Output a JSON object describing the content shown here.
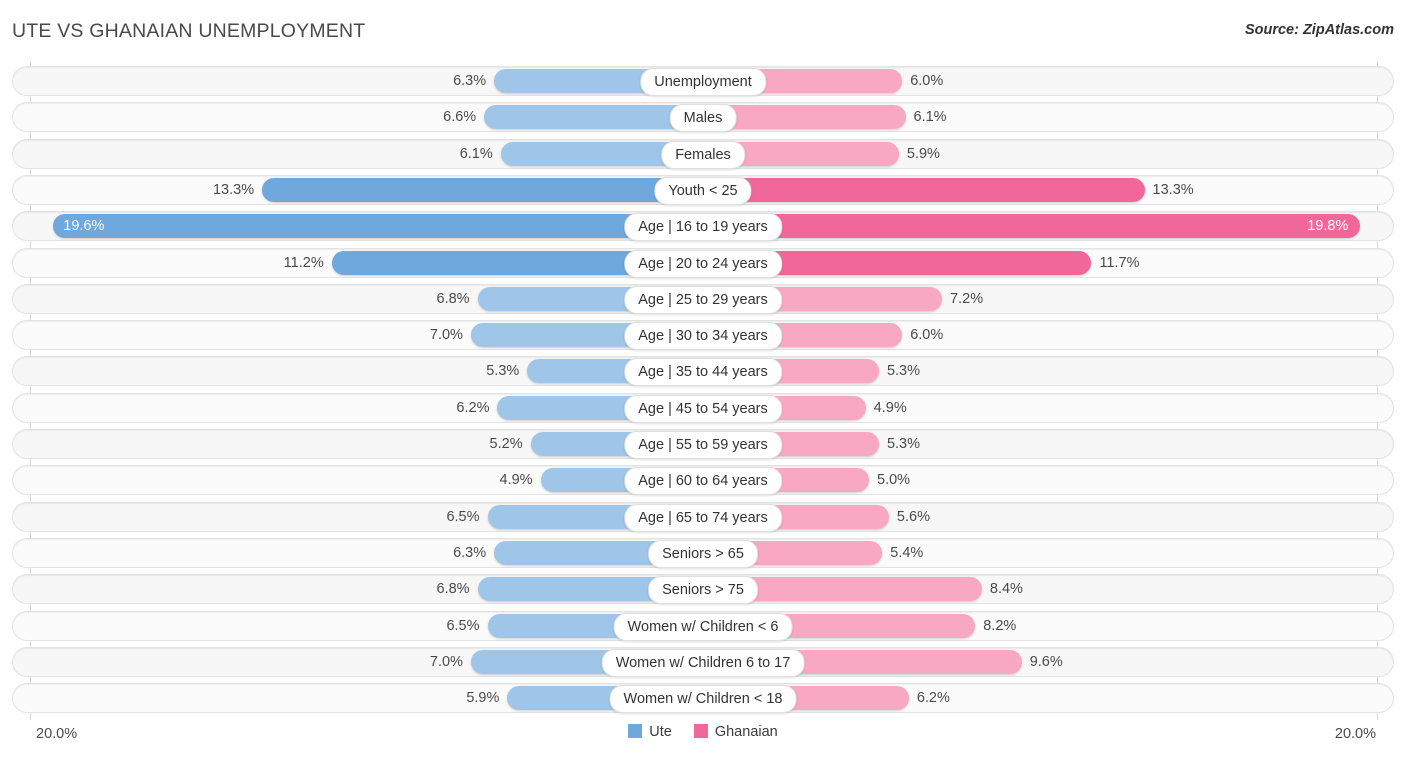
{
  "header": {
    "title": "UTE VS GHANAIAN UNEMPLOYMENT",
    "source": "Source: ZipAtlas.com"
  },
  "axis": {
    "left_tick": "20.0%",
    "right_tick": "20.0%",
    "max": 20.0
  },
  "legend": [
    {
      "label": "Ute",
      "color": "#6fa8dc"
    },
    {
      "label": "Ghanaian",
      "color": "#f2679a"
    }
  ],
  "colors": {
    "ute_light": "#9fc5e8",
    "ute_dark": "#6fa8dc",
    "ghanaian_light": "#f9a8c4",
    "ghanaian_dark": "#f2679a"
  },
  "chart_data": {
    "type": "bar",
    "title": "UTE VS GHANAIAN UNEMPLOYMENT",
    "subtitle": "Source: ZipAtlas.com",
    "orientation": "horizontal-diverging",
    "xlabel": "",
    "ylabel": "",
    "xlim": [
      20.0,
      20.0
    ],
    "grid": false,
    "legend_position": "bottom-center",
    "categories": [
      "Unemployment",
      "Males",
      "Females",
      "Youth < 25",
      "Age | 16 to 19 years",
      "Age | 20 to 24 years",
      "Age | 25 to 29 years",
      "Age | 30 to 34 years",
      "Age | 35 to 44 years",
      "Age | 45 to 54 years",
      "Age | 55 to 59 years",
      "Age | 60 to 64 years",
      "Age | 65 to 74 years",
      "Seniors > 65",
      "Seniors > 75",
      "Women w/ Children < 6",
      "Women w/ Children 6 to 17",
      "Women w/ Children < 18"
    ],
    "series": [
      {
        "name": "Ute",
        "side": "left",
        "values": [
          6.3,
          6.6,
          6.1,
          13.3,
          19.6,
          11.2,
          6.8,
          7.0,
          5.3,
          6.2,
          5.2,
          4.9,
          6.5,
          6.3,
          6.8,
          6.5,
          7.0,
          5.9
        ],
        "labels": [
          "6.3%",
          "6.6%",
          "6.1%",
          "13.3%",
          "19.6%",
          "11.2%",
          "6.8%",
          "7.0%",
          "5.3%",
          "6.2%",
          "5.2%",
          "4.9%",
          "6.5%",
          "6.3%",
          "6.8%",
          "6.5%",
          "7.0%",
          "5.9%"
        ]
      },
      {
        "name": "Ghanaian",
        "side": "right",
        "values": [
          6.0,
          6.1,
          5.9,
          13.3,
          19.8,
          11.7,
          7.2,
          6.0,
          5.3,
          4.9,
          5.3,
          5.0,
          5.6,
          5.4,
          8.4,
          8.2,
          9.6,
          6.2
        ],
        "labels": [
          "6.0%",
          "6.1%",
          "5.9%",
          "13.3%",
          "19.8%",
          "11.7%",
          "7.2%",
          "6.0%",
          "5.3%",
          "4.9%",
          "5.3%",
          "5.0%",
          "5.6%",
          "5.4%",
          "8.4%",
          "8.2%",
          "9.6%",
          "6.2%"
        ]
      }
    ]
  },
  "rows": [
    {
      "category": "Unemployment",
      "left_label": "6.3%",
      "right_label": "6.0%",
      "left_value": 6.3,
      "right_value": 6.0,
      "highlight": false
    },
    {
      "category": "Males",
      "left_label": "6.6%",
      "right_label": "6.1%",
      "left_value": 6.6,
      "right_value": 6.1,
      "highlight": false
    },
    {
      "category": "Females",
      "left_label": "6.1%",
      "right_label": "5.9%",
      "left_value": 6.1,
      "right_value": 5.9,
      "highlight": false
    },
    {
      "category": "Youth < 25",
      "left_label": "13.3%",
      "right_label": "13.3%",
      "left_value": 13.3,
      "right_value": 13.3,
      "highlight": true
    },
    {
      "category": "Age | 16 to 19 years",
      "left_label": "19.6%",
      "right_label": "19.8%",
      "left_value": 19.6,
      "right_value": 19.8,
      "highlight": true
    },
    {
      "category": "Age | 20 to 24 years",
      "left_label": "11.2%",
      "right_label": "11.7%",
      "left_value": 11.2,
      "right_value": 11.7,
      "highlight": true
    },
    {
      "category": "Age | 25 to 29 years",
      "left_label": "6.8%",
      "right_label": "7.2%",
      "left_value": 6.8,
      "right_value": 7.2,
      "highlight": false
    },
    {
      "category": "Age | 30 to 34 years",
      "left_label": "7.0%",
      "right_label": "6.0%",
      "left_value": 7.0,
      "right_value": 6.0,
      "highlight": false
    },
    {
      "category": "Age | 35 to 44 years",
      "left_label": "5.3%",
      "right_label": "5.3%",
      "left_value": 5.3,
      "right_value": 5.3,
      "highlight": false
    },
    {
      "category": "Age | 45 to 54 years",
      "left_label": "6.2%",
      "right_label": "4.9%",
      "left_value": 6.2,
      "right_value": 4.9,
      "highlight": false
    },
    {
      "category": "Age | 55 to 59 years",
      "left_label": "5.2%",
      "right_label": "5.3%",
      "left_value": 5.2,
      "right_value": 5.3,
      "highlight": false
    },
    {
      "category": "Age | 60 to 64 years",
      "left_label": "4.9%",
      "right_label": "5.0%",
      "left_value": 4.9,
      "right_value": 5.0,
      "highlight": false
    },
    {
      "category": "Age | 65 to 74 years",
      "left_label": "6.5%",
      "right_label": "5.6%",
      "left_value": 6.5,
      "right_value": 5.6,
      "highlight": false
    },
    {
      "category": "Seniors > 65",
      "left_label": "6.3%",
      "right_label": "5.4%",
      "left_value": 6.3,
      "right_value": 5.4,
      "highlight": false
    },
    {
      "category": "Seniors > 75",
      "left_label": "6.8%",
      "right_label": "8.4%",
      "left_value": 6.8,
      "right_value": 8.4,
      "highlight": false
    },
    {
      "category": "Women w/ Children < 6",
      "left_label": "6.5%",
      "right_label": "8.2%",
      "left_value": 6.5,
      "right_value": 8.2,
      "highlight": false
    },
    {
      "category": "Women w/ Children 6 to 17",
      "left_label": "7.0%",
      "right_label": "9.6%",
      "left_value": 7.0,
      "right_value": 9.6,
      "highlight": false
    },
    {
      "category": "Women w/ Children < 18",
      "left_label": "5.9%",
      "right_label": "6.2%",
      "left_value": 5.9,
      "right_value": 6.2,
      "highlight": false
    }
  ]
}
